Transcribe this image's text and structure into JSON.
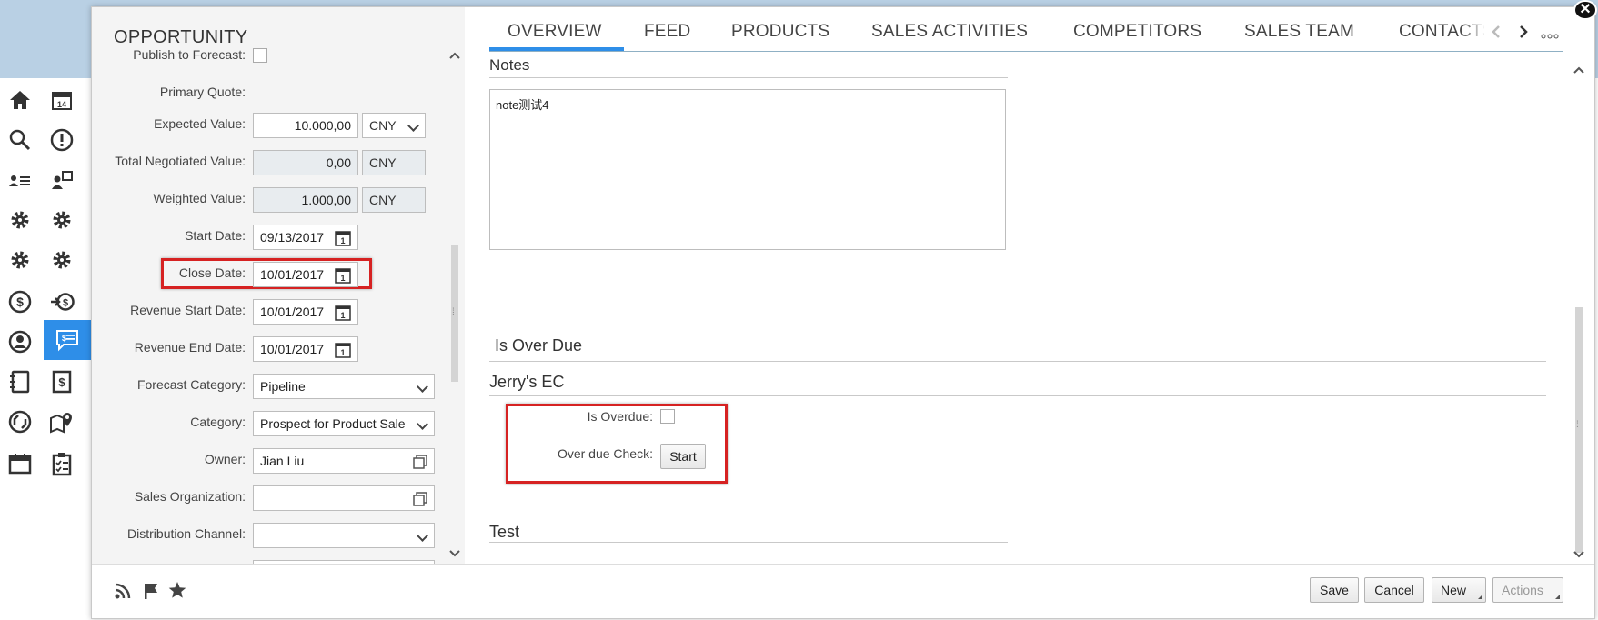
{
  "opportunity": {
    "title": "OPPORTUNITY",
    "fields": {
      "publish_to_forecast": {
        "label": "Publish to Forecast:",
        "checked": false
      },
      "primary_quote": {
        "label": "Primary Quote:"
      },
      "expected_value": {
        "label": "Expected Value:",
        "value": "10.000,00",
        "currency": "CNY"
      },
      "total_negotiated_value": {
        "label": "Total Negotiated Value:",
        "value": "0,00",
        "currency": "CNY"
      },
      "weighted_value": {
        "label": "Weighted Value:",
        "value": "1.000,00",
        "currency": "CNY"
      },
      "start_date": {
        "label": "Start Date:",
        "value": "09/13/2017"
      },
      "close_date": {
        "label": "Close Date:",
        "value": "10/01/2017"
      },
      "revenue_start_date": {
        "label": "Revenue Start Date:",
        "value": "10/01/2017"
      },
      "revenue_end_date": {
        "label": "Revenue End Date:",
        "value": "10/01/2017"
      },
      "forecast_category": {
        "label": "Forecast Category:",
        "value": "Pipeline"
      },
      "category": {
        "label": "Category:",
        "value": "Prospect for Product Sale"
      },
      "owner": {
        "label": "Owner:",
        "value": "Jian Liu"
      },
      "sales_organization": {
        "label": "Sales Organization:",
        "value": ""
      },
      "distribution_channel": {
        "label": "Distribution Channel:",
        "value": ""
      }
    }
  },
  "tabs": [
    {
      "label": "OVERVIEW",
      "active": true
    },
    {
      "label": "FEED"
    },
    {
      "label": "PRODUCTS"
    },
    {
      "label": "SALES ACTIVITIES"
    },
    {
      "label": "COMPETITORS"
    },
    {
      "label": "SALES TEAM"
    },
    {
      "label": "CONTACTS"
    }
  ],
  "sections": {
    "notes": {
      "title": "Notes",
      "text": "note测试4"
    },
    "is_over_due": {
      "title": "Is Over Due"
    },
    "jerrys_ec": {
      "title": "Jerry's EC",
      "is_overdue_label": "Is Overdue:",
      "is_overdue_checked": false,
      "over_due_check_label": "Over due Check:",
      "start_button": "Start"
    },
    "test": {
      "title": "Test"
    }
  },
  "footer": {
    "save": "Save",
    "cancel": "Cancel",
    "new": "New",
    "actions": "Actions"
  },
  "icons": {
    "nav": [
      "home-icon",
      "calendar-icon",
      "search-icon",
      "alert-icon",
      "contacts-list-icon",
      "accounts-icon",
      "gear-icon",
      "gear-icon",
      "gear-icon",
      "gear-icon",
      "dollar-icon",
      "transfer-dollar-icon",
      "person-icon",
      "quote-icon",
      "notebook-icon",
      "invoice-icon",
      "cycle-icon",
      "map-pin-icon",
      "calendar-plain-icon",
      "clipboard-icon"
    ]
  },
  "colors": {
    "accent": "#2e8ee8",
    "highlight_box": "#d62222",
    "top_band": "#b9d0e4"
  }
}
